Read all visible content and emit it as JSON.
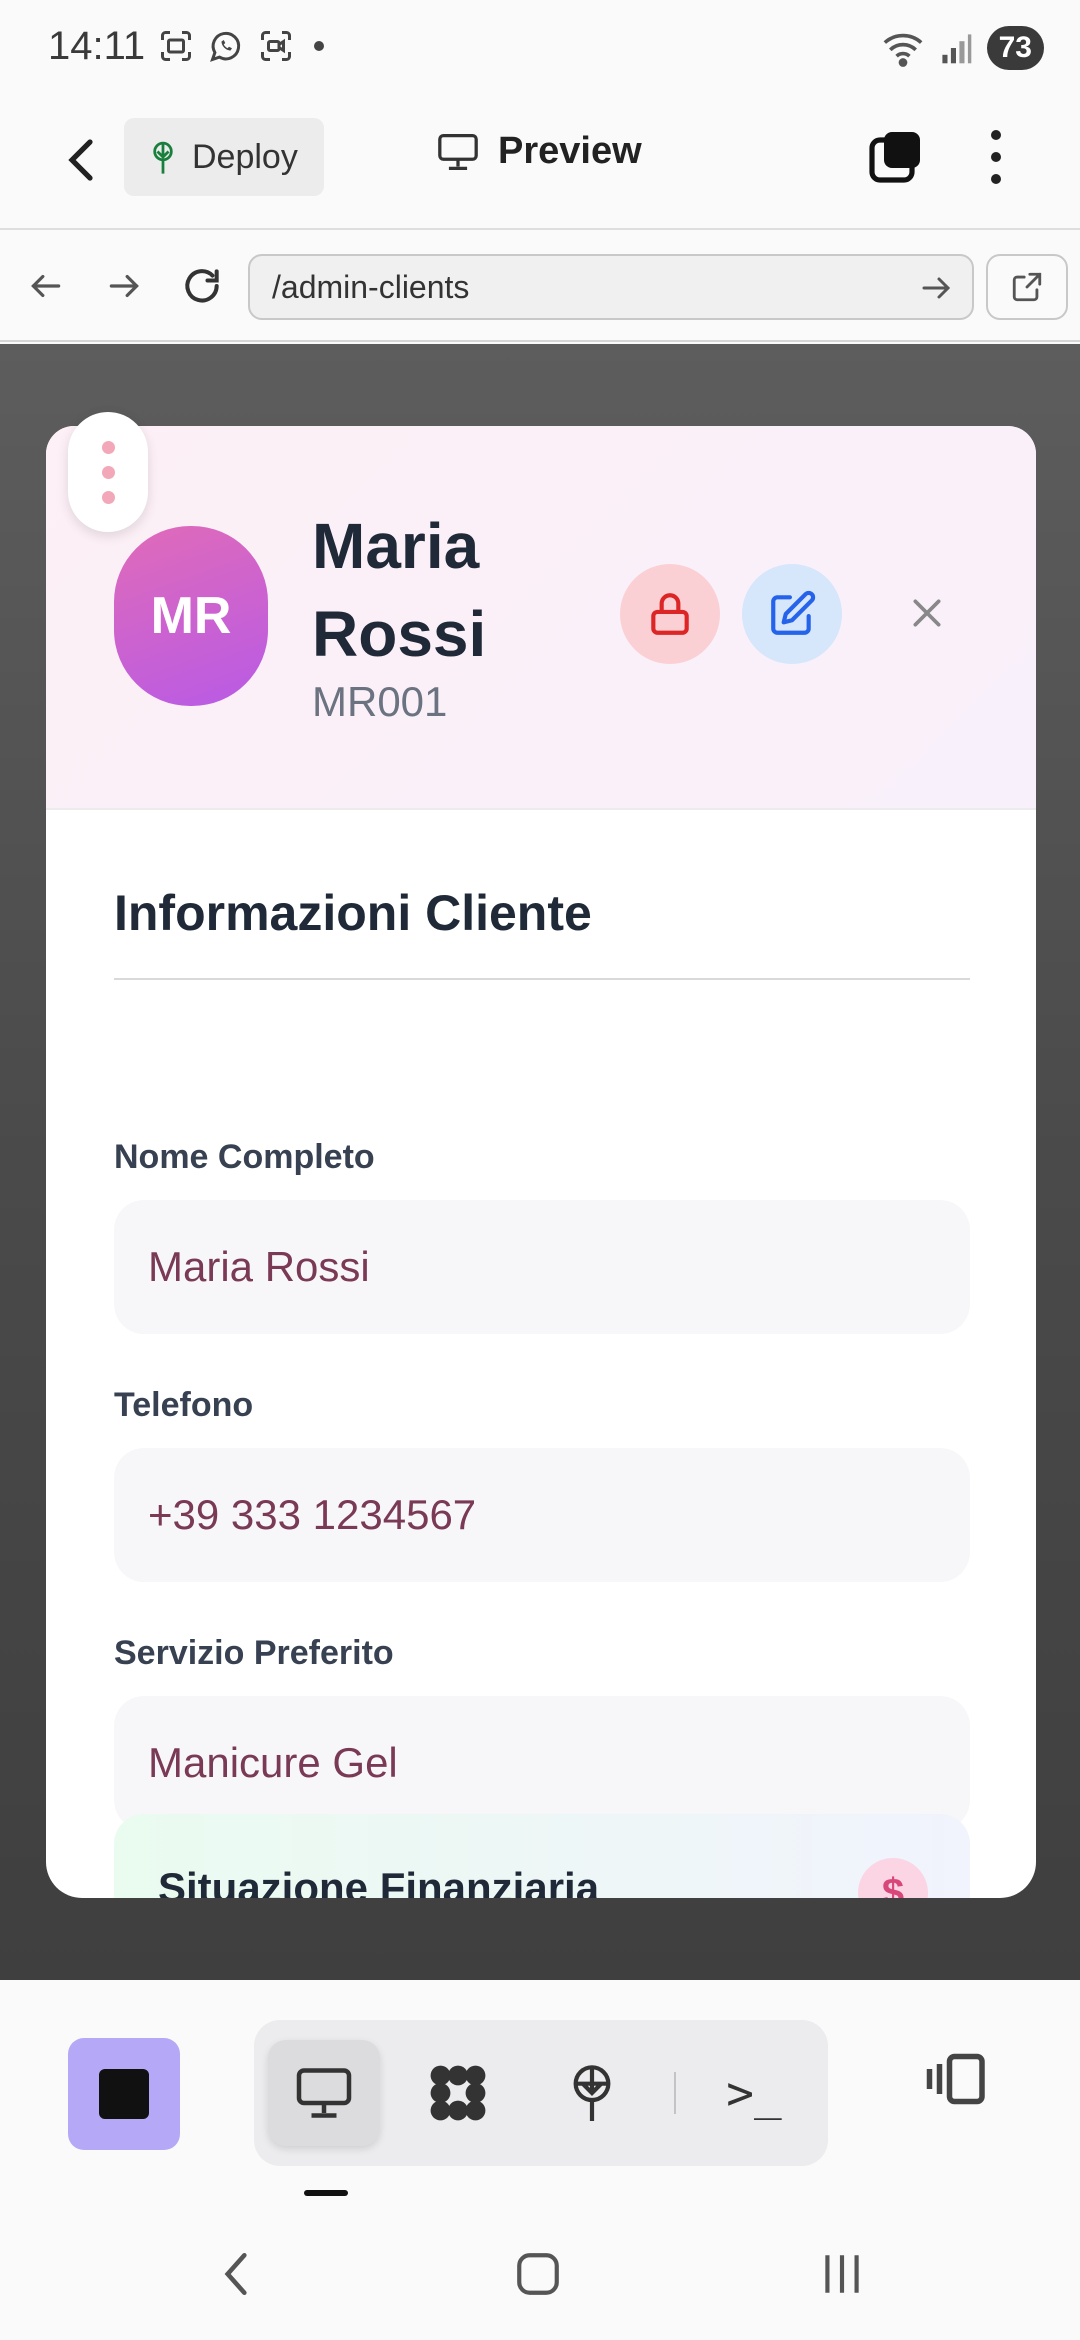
{
  "status_bar": {
    "time": "14:11",
    "battery": "73",
    "left_icons": [
      "screenshot-icon",
      "whatsapp-icon",
      "screen-record-icon",
      "dot-icon"
    ],
    "right_icons": [
      "wifi-icon",
      "signal-icon"
    ]
  },
  "toolbar": {
    "deploy_label": "Deploy",
    "preview_label": "Preview"
  },
  "urlbar": {
    "url": "/admin-clients"
  },
  "client": {
    "initials": "MR",
    "name": "Maria Rossi",
    "code": "MR001"
  },
  "section": {
    "title": "Informazioni Cliente"
  },
  "fields": [
    {
      "label": "Nome Completo",
      "value": "Maria Rossi"
    },
    {
      "label": "Telefono",
      "value": "+39 333 1234567"
    },
    {
      "label": "Servizio Preferito",
      "value": "Manicure Gel"
    }
  ],
  "finance": {
    "title": "Situazione Finanziaria",
    "icon_glyph": "$"
  },
  "dock": {
    "terminal_glyph": ">_"
  },
  "colors": {
    "avatar_start": "#e06bb8",
    "avatar_end": "#b85ae6",
    "lock_bg": "#fbd0d4",
    "lock_icon": "#dc2626",
    "edit_bg": "#d6e6fb",
    "edit_icon": "#2563eb",
    "field_text": "#7a3a55",
    "stop_button": "#b5a9f7"
  }
}
